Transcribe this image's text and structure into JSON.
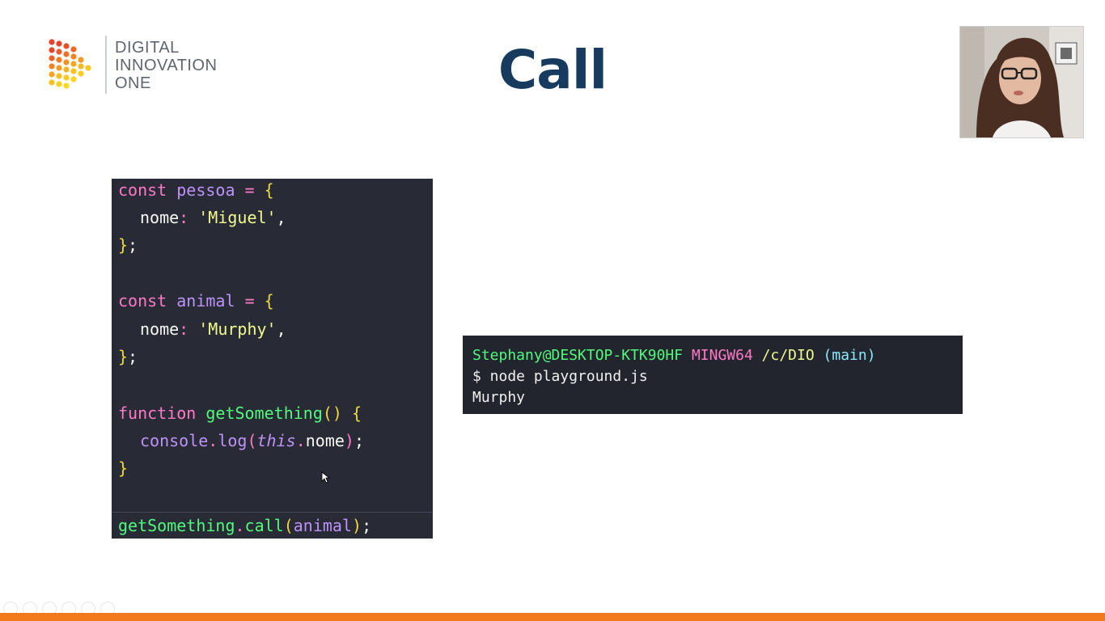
{
  "logo": {
    "line1": "DIGITAL",
    "line2": "INNOVATION",
    "line3": "ONE"
  },
  "slide": {
    "title": "Call"
  },
  "code": {
    "l1": {
      "kw": "const",
      "var": "pessoa",
      "op": "=",
      "brace": "{"
    },
    "l2": {
      "prop": "nome",
      "colon": ":",
      "str": "'Miguel'",
      "comma": ","
    },
    "l3": {
      "brace": "}",
      "semi": ";"
    },
    "l4": {
      "kw": "const",
      "var": "animal",
      "op": "=",
      "brace": "{"
    },
    "l5": {
      "prop": "nome",
      "colon": ":",
      "str": "'Murphy'",
      "comma": ","
    },
    "l6": {
      "brace": "}",
      "semi": ";"
    },
    "l7": {
      "kw": "function",
      "fn": "getSomething",
      "parens": "()",
      "brace": "{"
    },
    "l8": {
      "obj": "console",
      "dot": ".",
      "method": "log",
      "open": "(",
      "this": "this",
      "dot2": ".",
      "prop": "nome",
      "close": ")",
      "semi": ";"
    },
    "l9": {
      "brace": "}"
    },
    "l10": {
      "fn": "getSomething",
      "dot": ".",
      "method": "call",
      "open": "(",
      "arg": "animal",
      "close": ")",
      "semi": ";"
    }
  },
  "terminal": {
    "user": "Stephany@DESKTOP-KTK90HF",
    "mingw": "MINGW64",
    "path": "/c/DIO",
    "branch": "(main)",
    "command": "$ node playground.js",
    "output": "Murphy"
  },
  "colors": {
    "title": "#163b5f",
    "code_bg": "#282a36",
    "terminal_bg": "#23252e",
    "accent_bar": "#f27a1c"
  }
}
